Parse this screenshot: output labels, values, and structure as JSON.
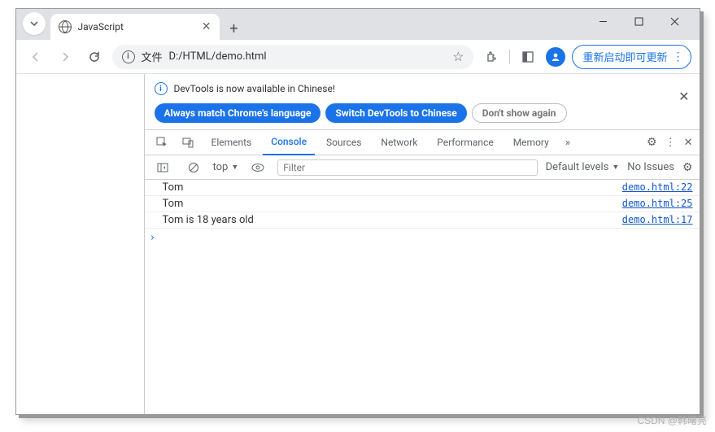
{
  "window": {
    "tab_title": "JavaScript"
  },
  "address": {
    "file_label": "文件",
    "url": "D:/HTML/demo.html",
    "update_label": "重新启动即可更新"
  },
  "devtools": {
    "info_text": "DevTools is now available in Chinese!",
    "pill_always": "Always match Chrome's language",
    "pill_switch": "Switch DevTools to Chinese",
    "pill_dont": "Don't show again",
    "tabs": {
      "elements": "Elements",
      "console": "Console",
      "sources": "Sources",
      "network": "Network",
      "performance": "Performance",
      "memory": "Memory"
    },
    "toolbar": {
      "context": "top",
      "filter_placeholder": "Filter",
      "levels": "Default levels",
      "issues": "No Issues"
    },
    "logs": [
      {
        "text": "Tom",
        "link": "demo.html:22"
      },
      {
        "text": "Tom",
        "link": "demo.html:25"
      },
      {
        "text": "Tom is 18 years old",
        "link": "demo.html:17"
      }
    ]
  },
  "watermark": "CSDN @韩曙亮"
}
